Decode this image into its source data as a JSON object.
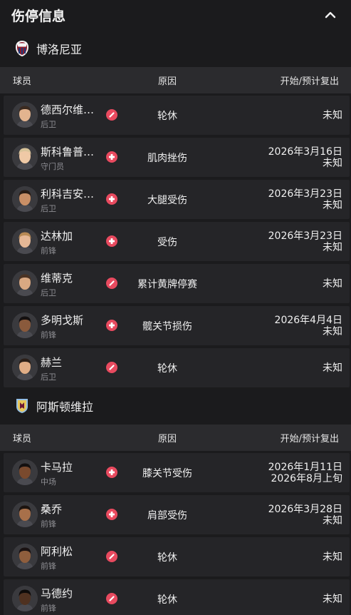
{
  "header": {
    "title": "伤停信息",
    "collapse_icon": "chevron-up-icon"
  },
  "colors": {
    "background": "#1b1b1d",
    "row": "#252528",
    "column_header": "#2b2b2e",
    "badge": "#e84a5f",
    "secondary_text": "#8e8e93"
  },
  "columns": {
    "player": "球员",
    "reason": "原因",
    "dates": "开始/预计复出"
  },
  "teams": [
    {
      "name": "博洛尼亚",
      "crest_icon": "bologna-crest-icon",
      "players": [
        {
          "name": "德西尔维…",
          "position": "后卫",
          "badge_icon": "suspension-icon",
          "reason": "轮休",
          "start": "",
          "return": "未知"
        },
        {
          "name": "斯科鲁普…",
          "position": "守门员",
          "badge_icon": "injury-cross-icon",
          "reason": "肌肉挫伤",
          "start": "2026年3月16日",
          "return": "未知"
        },
        {
          "name": "利科吉安…",
          "position": "后卫",
          "badge_icon": "injury-cross-icon",
          "reason": "大腿受伤",
          "start": "2026年3月23日",
          "return": "未知"
        },
        {
          "name": "达林加",
          "position": "前锋",
          "badge_icon": "injury-cross-icon",
          "reason": "受伤",
          "start": "2026年3月23日",
          "return": "未知"
        },
        {
          "name": "维蒂克",
          "position": "后卫",
          "badge_icon": "suspension-icon",
          "reason": "累计黄牌停赛",
          "start": "",
          "return": "未知"
        },
        {
          "name": "多明戈斯",
          "position": "前锋",
          "badge_icon": "injury-cross-icon",
          "reason": "髋关节损伤",
          "start": "2026年4月4日",
          "return": "未知"
        },
        {
          "name": "赫兰",
          "position": "后卫",
          "badge_icon": "suspension-icon",
          "reason": "轮休",
          "start": "",
          "return": "未知"
        }
      ]
    },
    {
      "name": "阿斯顿维拉",
      "crest_icon": "aston-villa-crest-icon",
      "players": [
        {
          "name": "卡马拉",
          "position": "中场",
          "badge_icon": "injury-cross-icon",
          "reason": "膝关节受伤",
          "start": "2026年1月11日",
          "return": "2026年8月上旬"
        },
        {
          "name": "桑乔",
          "position": "前锋",
          "badge_icon": "injury-cross-icon",
          "reason": "肩部受伤",
          "start": "2026年3月28日",
          "return": "未知"
        },
        {
          "name": "阿利松",
          "position": "前锋",
          "badge_icon": "suspension-icon",
          "reason": "轮休",
          "start": "",
          "return": "未知"
        },
        {
          "name": "马德约",
          "position": "前锋",
          "badge_icon": "suspension-icon",
          "reason": "轮休",
          "start": "",
          "return": "未知"
        }
      ]
    }
  ]
}
